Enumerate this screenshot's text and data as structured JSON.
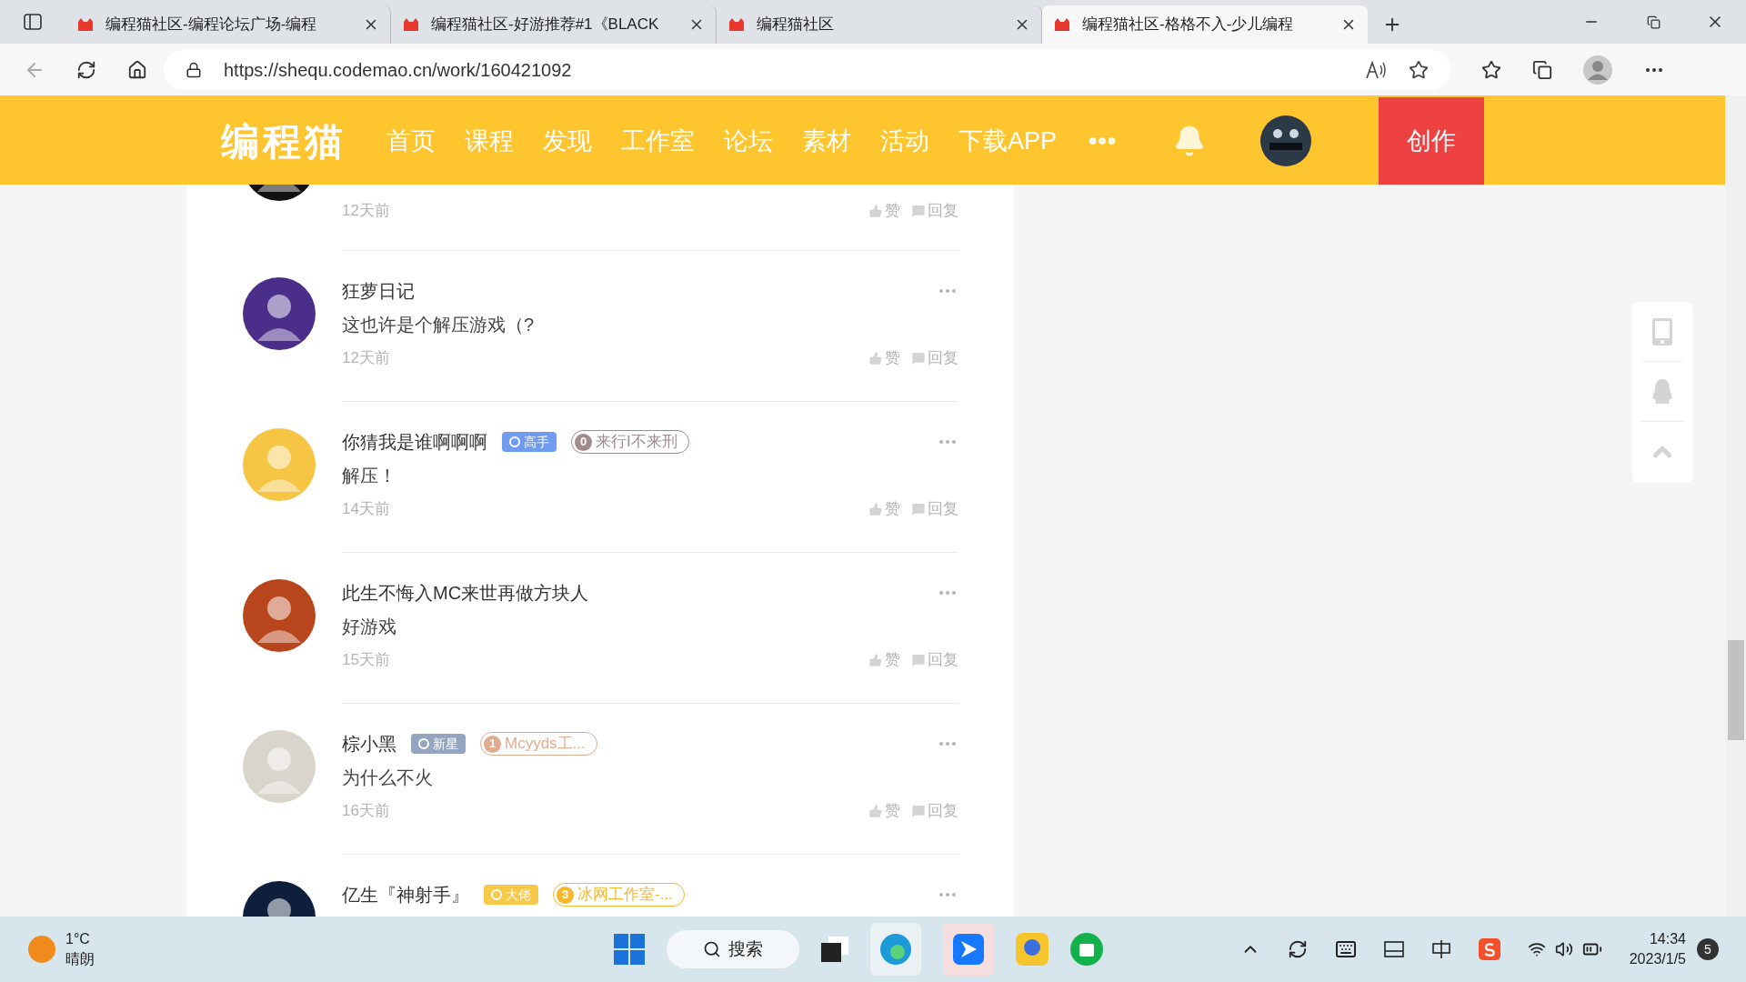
{
  "browser": {
    "tabs": [
      {
        "title": "编程猫社区-编程论坛广场-编程",
        "selected": false
      },
      {
        "title": "编程猫社区-好游推荐#1《BLACK",
        "selected": false
      },
      {
        "title": "编程猫社区",
        "selected": false
      },
      {
        "title": "编程猫社区-格格不入-少儿编程",
        "selected": true
      }
    ],
    "url": "https://shequ.codemao.cn/work/160421092"
  },
  "site_header": {
    "logo": "编程猫",
    "nav": [
      "首页",
      "课程",
      "发现",
      "工作室",
      "论坛",
      "素材",
      "活动",
      "下载APP"
    ],
    "create_button": "创作"
  },
  "comments": [
    {
      "kind": "partial",
      "time": "12天前",
      "like": "赞",
      "reply": "回复"
    },
    {
      "kind": "full",
      "name": "狂萝日记",
      "content": "这也许是个解压游戏（?",
      "time": "12天前",
      "like": "赞",
      "reply": "回复"
    },
    {
      "kind": "full",
      "name": "你猜我是谁啊啊啊",
      "badges": [
        {
          "kind": "rank",
          "text": "高手",
          "color": "#6f9cf0"
        },
        {
          "kind": "studio",
          "number": "0",
          "text": "来行I不来刑",
          "color": "#a08c8c"
        }
      ],
      "content": "解压！",
      "time": "14天前",
      "like": "赞",
      "reply": "回复"
    },
    {
      "kind": "full",
      "name": "此生不悔入MC来世再做方块人",
      "content": "好游戏",
      "time": "15天前",
      "like": "赞",
      "reply": "回复"
    },
    {
      "kind": "full",
      "name": "棕小黑",
      "badges": [
        {
          "kind": "rank",
          "text": "新星",
          "color": "#94a6bf"
        },
        {
          "kind": "studio",
          "number": "1",
          "text": "Mcyyds工...",
          "color": "#e0ab8f"
        }
      ],
      "content": "为什么不火",
      "time": "16天前",
      "like": "赞",
      "reply": "回复"
    },
    {
      "kind": "cut",
      "name": "亿生『神射手』",
      "badges": [
        {
          "kind": "rank",
          "text": "大佬",
          "color": "#f7c948"
        },
        {
          "kind": "studio",
          "number": "3",
          "text": "冰网工作室-...",
          "color": "#f5b72d"
        }
      ]
    }
  ],
  "taskbar": {
    "temperature": "1°C",
    "weather": "晴朗",
    "search": "搜索",
    "time": "14:34",
    "date": "2023/1/5",
    "notifications": "5"
  }
}
